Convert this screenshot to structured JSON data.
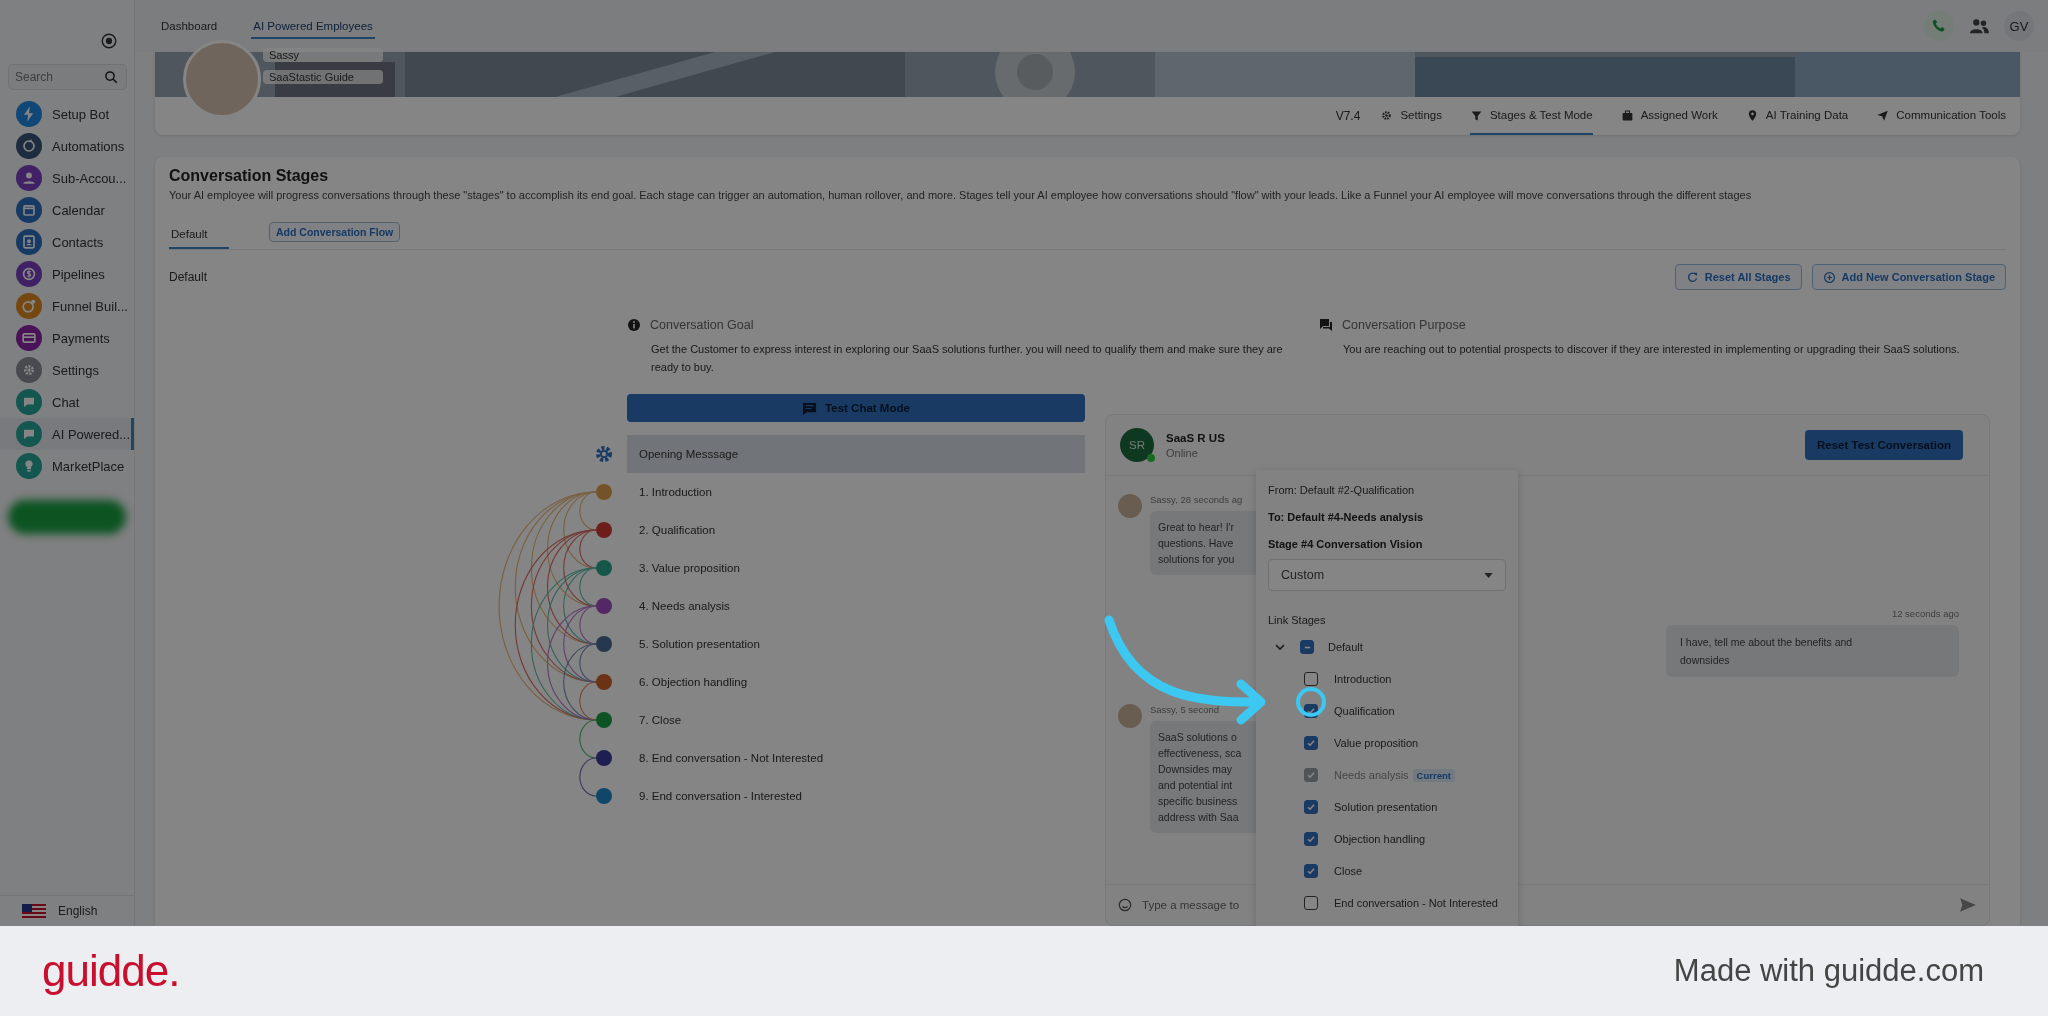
{
  "sidebar": {
    "search": {
      "placeholder": "Search"
    },
    "items": [
      {
        "label": "Setup Bot",
        "color": "#104777",
        "selected": false
      },
      {
        "label": "Automations",
        "color": "#1d2d3f",
        "selected": false
      },
      {
        "label": "Sub-Accou...",
        "color": "#402166",
        "selected": false
      },
      {
        "label": "Calendar",
        "color": "#173a64",
        "selected": false
      },
      {
        "label": "Contacts",
        "color": "#173a64",
        "selected": false
      },
      {
        "label": "Pipelines",
        "color": "#402166",
        "selected": false
      },
      {
        "label": "Funnel Buil...",
        "color": "#744810",
        "selected": false
      },
      {
        "label": "Payments",
        "color": "#4a1358",
        "selected": false
      },
      {
        "label": "Settings",
        "color": "#484a4f",
        "selected": false
      },
      {
        "label": "Chat",
        "color": "#145650",
        "selected": false
      },
      {
        "label": "AI Powered...",
        "color": "#145650",
        "selected": true
      },
      {
        "label": "MarketPlace",
        "color": "#145650",
        "selected": false
      }
    ],
    "language": "English"
  },
  "top_tabs": [
    {
      "label": "Dashboard",
      "selected": false
    },
    {
      "label": "AI Powered Employees",
      "selected": true
    }
  ],
  "user_initials": "GV",
  "profile": {
    "name": "Sassy",
    "subtitle": "SaaStastic Guide"
  },
  "version": "V7.4",
  "nav_tabs": [
    {
      "label": "Settings",
      "selected": false
    },
    {
      "label": "Stages & Test Mode",
      "selected": true
    },
    {
      "label": "Assigned Work",
      "selected": false
    },
    {
      "label": "AI Training Data",
      "selected": false
    },
    {
      "label": "Communication Tools",
      "selected": false
    }
  ],
  "stages": {
    "title": "Conversation Stages",
    "description": "Your AI employee will progress conversations through these \"stages\" to accomplish its end goal. Each stage can trigger an automation, human rollover, and more. Stages tell your AI employee how conversations should \"flow\" with your leads. Like a Funnel your AI employee will move conversations through the different stages",
    "flow_tabs": [
      {
        "label": "Default",
        "selected": true
      }
    ],
    "add_flow_button": "Add Conversation Flow",
    "flow_name": "Default",
    "buttons": [
      "Reset All Stages",
      "Add New Conversation Stage"
    ],
    "goal": {
      "heading": "Conversation Goal",
      "text": "Get the Customer to express interest in exploring our SaaS solutions further. you will need to qualify them and make sure they are ready to buy."
    },
    "purpose": {
      "heading": "Conversation Purpose",
      "text": "You are reaching out to potential prospects to discover if they are interested in implementing or upgrading their SaaS solutions."
    },
    "test_button": "Test Chat Mode",
    "opening": {
      "label": "Opening Messsage",
      "selected": true
    },
    "items": [
      {
        "label": "1. Introduction",
        "color": "#74532a",
        "selected": false
      },
      {
        "label": "2. Qualification",
        "color": "#6c1e1a",
        "selected": false
      },
      {
        "label": "3. Value proposition",
        "color": "#165749",
        "selected": false
      },
      {
        "label": "4. Needs analysis",
        "color": "#542866",
        "selected": false
      },
      {
        "label": "5. Solution presentation",
        "color": "#263750",
        "selected": false
      },
      {
        "label": "6. Objection handling",
        "color": "#6c3216",
        "selected": false
      },
      {
        "label": "7. Close",
        "color": "#0e5326",
        "selected": false
      },
      {
        "label": "8. End conversation - Not Interested",
        "color": "#1f1e53",
        "selected": false
      },
      {
        "label": "9. End conversation - Interested",
        "color": "#104768",
        "selected": false
      }
    ]
  },
  "chat": {
    "contact": {
      "initials": "SR",
      "name": "SaaS R US",
      "status": "Online"
    },
    "reset_button": "Reset Test Conversation",
    "messages": [
      {
        "kind": "bot",
        "meta": "Sassy, 28 seconds ag",
        "lines": [
          "Great to hear! I'r",
          "questions. Have",
          "solutions for you"
        ]
      },
      {
        "kind": "user",
        "meta": "12 seconds ago",
        "lines": [
          "I have, tell me about the benefits and",
          "downsides"
        ]
      },
      {
        "kind": "bot",
        "meta": "Sassy, 5 second",
        "lines": [
          "SaaS solutions o",
          "effectiveness, sca",
          "Downsides may",
          "and potential int",
          "specific business",
          "address with Saa"
        ]
      }
    ],
    "input_placeholder": "Type a message to"
  },
  "popover": {
    "from": "From: Default #2-Qualification",
    "to": "To: Default #4-Needs analysis",
    "vision_label": "Stage #4 Conversation Vision",
    "vision_value": "Custom",
    "link_label": "Link Stages",
    "group": {
      "label": "Default",
      "expanded": true,
      "indeterminate": true,
      "children": [
        {
          "label": "Introduction",
          "checked": false,
          "disabled": false
        },
        {
          "label": "Qualification",
          "checked": true,
          "disabled": false
        },
        {
          "label": "Value proposition",
          "checked": true,
          "disabled": false
        },
        {
          "label": "Needs analysis",
          "checked": true,
          "disabled": true,
          "badge": "Current"
        },
        {
          "label": "Solution presentation",
          "checked": true,
          "disabled": false
        },
        {
          "label": "Objection handling",
          "checked": true,
          "disabled": false
        },
        {
          "label": "Close",
          "checked": true,
          "disabled": false
        },
        {
          "label": "End conversation - Not Interested",
          "checked": false,
          "disabled": false
        }
      ]
    }
  },
  "footer": {
    "logo": "guidde.",
    "credit": "Made with guidde.com"
  }
}
